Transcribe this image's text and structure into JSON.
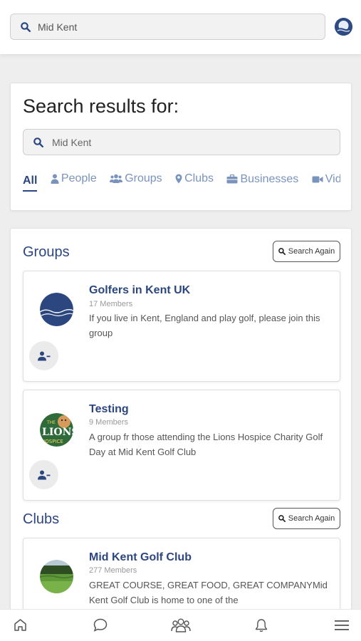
{
  "header": {
    "search_value": "Mid Kent"
  },
  "results": {
    "title": "Search results for:",
    "search_value": "Mid Kent",
    "tabs": [
      {
        "label": "All"
      },
      {
        "label": "People"
      },
      {
        "label": "Groups"
      },
      {
        "label": "Clubs"
      },
      {
        "label": "Businesses"
      },
      {
        "label": "Videos"
      }
    ]
  },
  "groups": {
    "title": "Groups",
    "search_again": "Search Again",
    "items": [
      {
        "title": "Golfers in Kent UK",
        "members": "17 Members",
        "description": "If you live in Kent, England and play golf, please join this group"
      },
      {
        "title": "Testing",
        "members": "9 Members",
        "description": "A group fr those attending the Lions Hospice Charity Golf Day at Mid Kent Golf Club",
        "logo_text_top": "THE",
        "logo_text_mid": "LIONS",
        "logo_text_bottom": "HOSPICE"
      }
    ]
  },
  "clubs": {
    "title": "Clubs",
    "search_again": "Search Again",
    "items": [
      {
        "title": "Mid Kent Golf Club",
        "members": "277 Members",
        "description": "GREAT COURSE, GREAT FOOD, GREAT COMPANYMid Kent Golf Club is home to one of the"
      }
    ]
  },
  "colors": {
    "accent": "#2c4680",
    "tab_inactive": "#7a93bd"
  },
  "bottom_nav": [
    "home-icon",
    "chat-icon",
    "groups-icon",
    "bell-icon",
    "menu-icon"
  ]
}
